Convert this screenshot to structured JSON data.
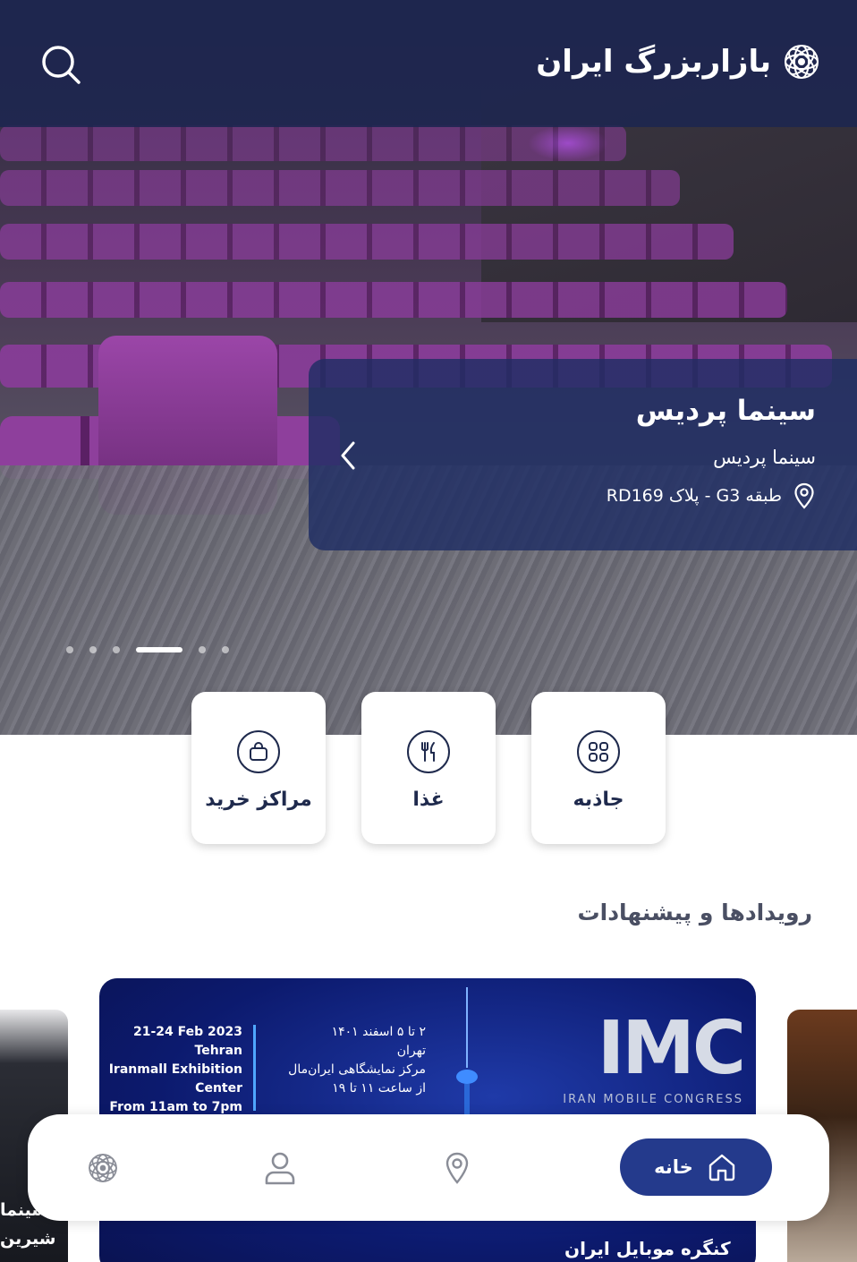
{
  "header": {
    "logo_text": "بازاربزرگ ایران",
    "logo_icon": "iranmall-emblem-icon",
    "search_icon": "search-icon"
  },
  "hero": {
    "title": "سینما پردیس",
    "subtitle": "سینما پردیس",
    "location": "طبقه G3 - پلاک RD169",
    "carousel": {
      "total": 6,
      "active_index": 3
    }
  },
  "categories": [
    {
      "label": "مراکز خرید",
      "icon": "shopping-bag-icon"
    },
    {
      "label": "غذا",
      "icon": "food-icon"
    },
    {
      "label": "جاذبه",
      "icon": "grid-icon"
    }
  ],
  "events": {
    "title": "رویدادها و پیشنهادات",
    "main": {
      "date_en": [
        "21-24 Feb 2023",
        "Tehran",
        "Iranmall Exhibition Center",
        "From 11am to 7pm"
      ],
      "date_fa": [
        "۲ تا ۵ اسفند ۱۴۰۱",
        "تهران",
        "مرکز نمایشگاهی ایران‌مال",
        "از ساعت ۱۱ تا ۱۹"
      ],
      "logo": "IMC",
      "logo_sub": "IRAN MOBILE CONGRESS",
      "caption": "کنگره موبایل ایران"
    },
    "left_card_text": [
      "سینما",
      "شیرین"
    ]
  },
  "bottom_nav": {
    "home_label": "خانه",
    "items": [
      "home-icon",
      "location-icon",
      "profile-icon",
      "iranmall-emblem-icon"
    ]
  },
  "colors": {
    "primary": "#243a8c",
    "header_bg": "#1c2550",
    "text_dark": "#1f2a4d"
  }
}
